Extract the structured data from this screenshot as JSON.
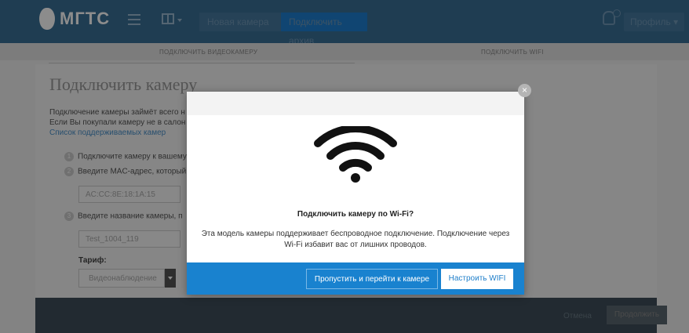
{
  "header": {
    "logo_text": "МГТС",
    "nav": {
      "new_camera": "Новая камера",
      "connect_archive": "Подключить архив"
    },
    "profile": "Профиль ▾"
  },
  "steps": {
    "step1": "ПОДКЛЮЧИТЬ ВИДЕОКАМЕРУ",
    "step2": "ПОДКЛЮЧИТЬ WIFI"
  },
  "page": {
    "title": "Подключить камеру",
    "intro_line1": "Подключение камеры займёт всего н",
    "intro_line2": "Если Вы покупали камеру не в салон",
    "intro_link": "Список поддерживаемых камер",
    "items": [
      {
        "num": "1",
        "text": "Подключите камеру к вашему"
      },
      {
        "num": "2",
        "text": "Введите MAC-адрес, который"
      },
      {
        "num": "3",
        "text": "Введите название камеры, п"
      }
    ],
    "mac_value": "AC:CC:8E:18:1A:15",
    "name_value": "Test_1004_119",
    "tariff_label": "Тариф:",
    "tariff_value": "Видеонаблюдение"
  },
  "footer": {
    "cancel": "Отмена",
    "continue": "Продолжить"
  },
  "modal": {
    "close": "×",
    "heading": "Подключить камеру по Wi-Fi?",
    "text": "Эта модель камеры поддерживает беспроводное подключение. Подключение через Wi-Fi избавит вас от лишних проводов.",
    "skip_button": "Пропустить и перейти к камере",
    "wifi_button": "Настроить WIFI"
  },
  "icons": {
    "wifi": "wifi-icon",
    "close": "close-icon",
    "menu": "hamburger-icon",
    "bell": "bell-icon",
    "layout": "layout-icon"
  },
  "colors": {
    "brand_blue": "#1982cf",
    "topbar": "#3a6f96",
    "footer": "#3f4e5a"
  }
}
